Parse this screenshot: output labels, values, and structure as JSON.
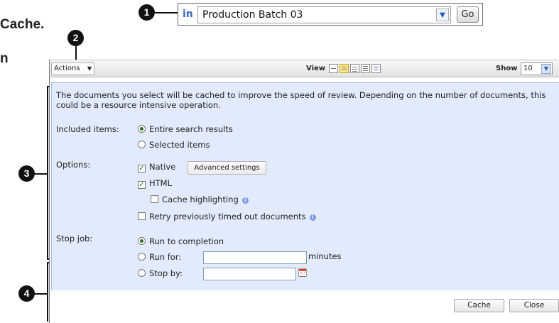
{
  "manual": {
    "fragment_1": "Cache.",
    "fragment_2": "n"
  },
  "callouts": [
    "1",
    "2",
    "3",
    "4"
  ],
  "batch_selector": {
    "prefix": "in",
    "value": "Production Batch 03",
    "go_label": "Go",
    "prefix_color": "#3b64c4"
  },
  "toolbar": {
    "actions_label": "Actions",
    "view_label": "View",
    "view_icons": [
      "collapse-view-icon",
      "highlight-view-icon",
      "list-view-icon",
      "detail-view-icon",
      "preview-view-icon"
    ],
    "show_label": "Show",
    "show_value": "10"
  },
  "form": {
    "intro": "The documents you select will be cached to improve the speed of review. Depending on the number of documents, this could be a resource intensive operation.",
    "included_items": {
      "label": "Included items:",
      "options": [
        {
          "label": "Entire search results",
          "selected": true
        },
        {
          "label": "Selected items",
          "selected": false
        }
      ]
    },
    "options": {
      "label": "Options:",
      "native": {
        "label": "Native",
        "checked": true
      },
      "advanced_settings_label": "Advanced settings",
      "html": {
        "label": "HTML",
        "checked": true
      },
      "cache_highlighting": {
        "label": "Cache highlighting",
        "checked": false
      },
      "retry": {
        "label": "Retry previously timed out documents",
        "checked": false
      }
    },
    "stop_job": {
      "label": "Stop job:",
      "run_to_completion": {
        "label": "Run to completion",
        "selected": true
      },
      "run_for": {
        "label": "Run for:",
        "selected": false,
        "value": "",
        "unit": "minutes"
      },
      "stop_by": {
        "label": "Stop by:",
        "selected": false,
        "value": ""
      }
    }
  },
  "footer": {
    "cache_label": "Cache",
    "close_label": "Close"
  },
  "colors": {
    "panel_background": "#e2ebfb",
    "radio_selected": "#2a6e2a"
  }
}
